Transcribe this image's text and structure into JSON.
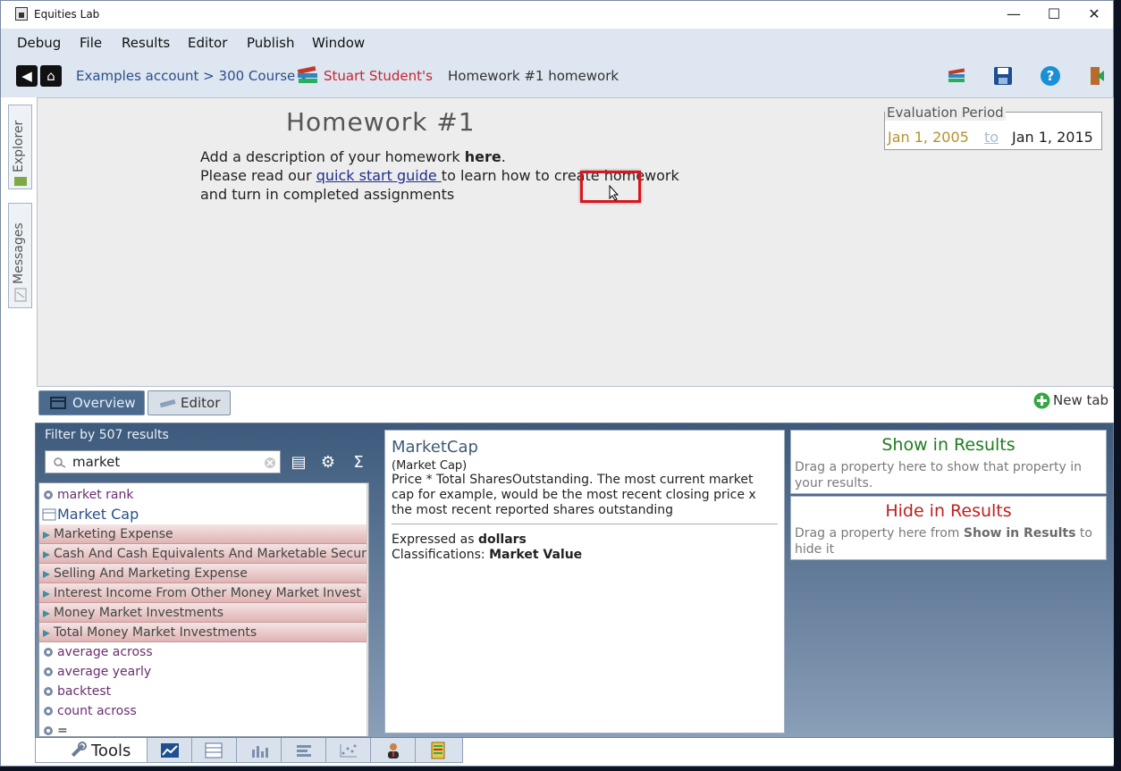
{
  "window": {
    "title": "Equities Lab",
    "minimize": "—",
    "maximize": "☐",
    "close": "✕"
  },
  "menu": [
    "Debug",
    "File",
    "Results",
    "Editor",
    "Publish",
    "Window"
  ],
  "breadcrumb": {
    "part1": "Examples account > 300 Course >",
    "owner": "Stuart Student's",
    "item": "Homework #1 homework"
  },
  "sidebar": {
    "explorer": "Explorer",
    "messages": "Messages"
  },
  "homework": {
    "title": "Homework #1",
    "line1_prefix": "Add a description of your homework ",
    "line1_bold": "here",
    "line1_suffix": ".",
    "line2_prefix": "Please read our ",
    "line2_link": "quick start guide ",
    "line2_suffix": "to learn how to create homework",
    "line3": "and turn in completed assignments"
  },
  "evaluation": {
    "legend": "Evaluation Period",
    "start": "Jan 1, 2005",
    "to": "to",
    "end": "Jan 1, 2015"
  },
  "tabs": {
    "overview": "Overview",
    "editor": "Editor",
    "new_tab": "New tab"
  },
  "filter": {
    "label": "Filter by 507 results",
    "search_value": "market"
  },
  "list": [
    {
      "label": "market rank",
      "style": "plain",
      "icon": "eye"
    },
    {
      "label": "Market Cap",
      "style": "selected",
      "icon": "table"
    },
    {
      "label": "Marketing Expense",
      "style": "pink",
      "icon": "arrow"
    },
    {
      "label": "Cash And Cash Equivalents And Marketable Securi",
      "style": "pink",
      "icon": "arrow"
    },
    {
      "label": "Selling And Marketing Expense",
      "style": "pink",
      "icon": "arrow"
    },
    {
      "label": "Interest Income From Other Money Market Invest",
      "style": "pink",
      "icon": "arrow"
    },
    {
      "label": "Money Market Investments",
      "style": "pink",
      "icon": "arrow"
    },
    {
      "label": "Total Money Market Investments",
      "style": "pink",
      "icon": "arrow"
    },
    {
      "label": "average across",
      "style": "plain",
      "icon": "eye"
    },
    {
      "label": "average yearly",
      "style": "plain",
      "icon": "eye"
    },
    {
      "label": "backtest",
      "style": "plain",
      "icon": "eye"
    },
    {
      "label": "count across",
      "style": "plain",
      "icon": "eye"
    },
    {
      "label": "=",
      "style": "plain",
      "icon": "eye"
    }
  ],
  "detail": {
    "name": "MarketCap",
    "alias": "(Market Cap)",
    "description": "Price * Total SharesOutstanding. The most current market cap for example, would be the most recent closing price x the most recent reported shares outstanding",
    "expressed_prefix": "Expressed as ",
    "expressed_value": "dollars",
    "class_prefix": "Classifications: ",
    "class_value": "Market Value"
  },
  "show_zone": {
    "title": "Show in Results",
    "desc": "Drag a property here to show that property in your results."
  },
  "hide_zone": {
    "title": "Hide in Results",
    "desc_prefix": "Drag a property here from ",
    "desc_bold": "Show in Results",
    "desc_suffix": " to hide it"
  },
  "bottom_tabs": {
    "tools": "Tools"
  },
  "colors": {
    "accent": "#4a6a8e",
    "show_green": "#1e7d1e",
    "hide_red": "#c01e1e",
    "highlight": "#d8161e"
  }
}
